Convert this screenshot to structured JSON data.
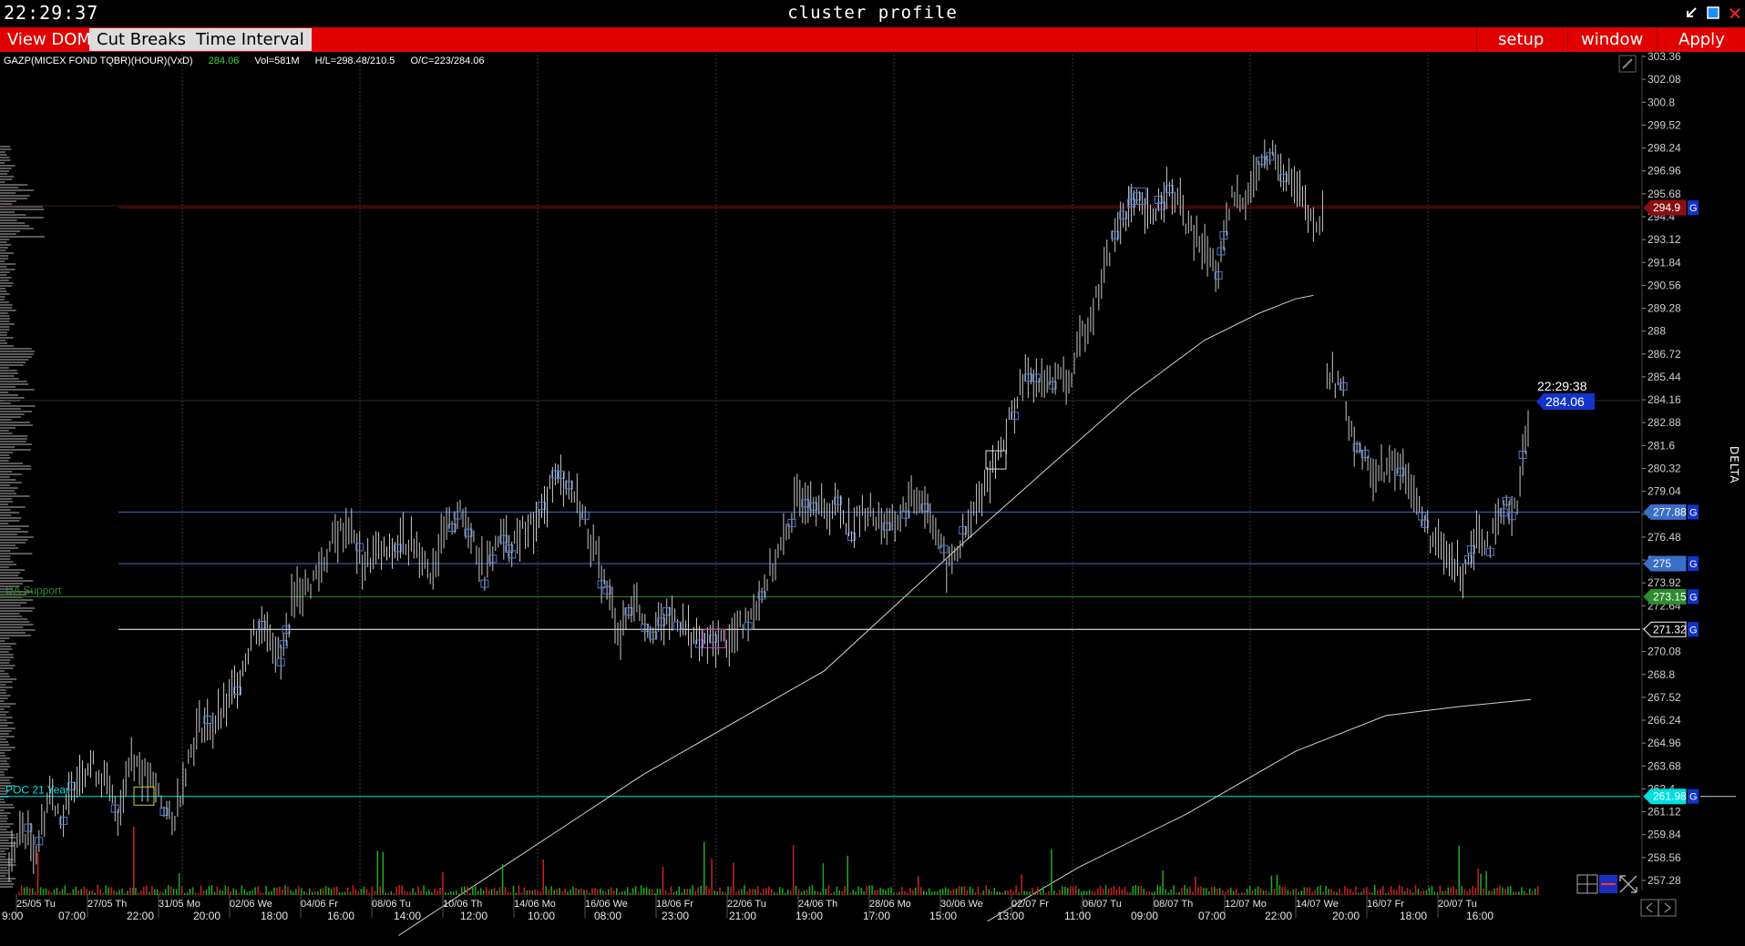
{
  "window": {
    "clock": "22:29:37",
    "title": "cluster profile"
  },
  "menu": {
    "view_dom": "View DOM",
    "cut_breaks": "Cut Breaks",
    "time_interval": "Time Interval",
    "setup": "setup",
    "window": "window",
    "apply": "Apply"
  },
  "info": {
    "symbol": "GAZP(MICEX FOND TQBR)(HOUR)(VxD)",
    "last": "284.06",
    "volume": "Vol=581M",
    "high_low": "H/L=298.48/210.5",
    "open_close": "O/C=223/284.06"
  },
  "colors": {
    "menu_red": "#e00000",
    "bull_volume": "#22aa22",
    "bear_volume": "#cc2222",
    "price_bar": "#c8c8c8",
    "blue_level": "#3a6ec8",
    "cyan_level": "#00e0e0",
    "green_level": "#2e8b2e",
    "red_level": "#8a1010",
    "last_price_tag": "#1133cc"
  },
  "chart_data": {
    "type": "candlestick-hourly",
    "y_ticks": [
      "303.36",
      "302.08",
      "300.8",
      "299.52",
      "298.24",
      "296.96",
      "295.68",
      "294.4",
      "293.12",
      "291.84",
      "290.56",
      "289.28",
      "288",
      "286.72",
      "285.44",
      "284.16",
      "282.88",
      "281.6",
      "280.32",
      "279.04",
      "277.76",
      "276.48",
      "275.2",
      "273.92",
      "272.64",
      "271.36",
      "270.08",
      "268.8",
      "267.52",
      "266.24",
      "264.96",
      "263.68",
      "262.4",
      "261.12",
      "259.84",
      "258.56",
      "257.28"
    ],
    "x_date_labels": [
      "25/05 Tu",
      "27/05 Th",
      "31/05 Mo",
      "02/06 We",
      "04/06 Fr",
      "08/06 Tu",
      "10/06 Th",
      "14/06 Mo",
      "16/06 We",
      "18/06 Fr",
      "22/06 Tu",
      "24/06 Th",
      "28/06 Mo",
      "30/06 We",
      "02/07 Fr",
      "06/07 Tu",
      "08/07 Th",
      "12/07 Mo",
      "14/07 We",
      "16/07 Fr",
      "20/07 Tu"
    ],
    "x_time_labels": [
      "9:00",
      "07:00",
      "22:00",
      "20:00",
      "18:00",
      "16:00",
      "14:00",
      "12:00",
      "10:00",
      "08:00",
      "23:00",
      "21:00",
      "19:00",
      "17:00",
      "15:00",
      "13:00",
      "11:00",
      "09:00",
      "07:00",
      "22:00",
      "20:00",
      "18:00",
      "16:00"
    ],
    "last_price": 284.06,
    "last_time": "22:29:38",
    "levels": [
      {
        "price": 294.9,
        "label": "294.9",
        "color": "#8a1010"
      },
      {
        "price": 277.88,
        "label": "277.88",
        "color": "#3a6ec8"
      },
      {
        "price": 275,
        "label": "275",
        "color": "#3a6ec8"
      },
      {
        "price": 273.15,
        "label": "273.15",
        "color": "#2e8b2e",
        "name": "DA Support"
      },
      {
        "price": 271.32,
        "label": "271.32",
        "color": "#ffffff"
      },
      {
        "price": 261.98,
        "label": "261.98",
        "color": "#00e0e0",
        "name": "POC 21 Year"
      }
    ],
    "price_path": [
      [
        0,
        258.3
      ],
      [
        15,
        260.2
      ],
      [
        30,
        259
      ],
      [
        45,
        262.3
      ],
      [
        60,
        260.7
      ],
      [
        75,
        263.3
      ],
      [
        90,
        263.8
      ],
      [
        105,
        262.9
      ],
      [
        120,
        261
      ],
      [
        135,
        264.4
      ],
      [
        150,
        263.1
      ],
      [
        165,
        262.2
      ],
      [
        180,
        260.3
      ],
      [
        195,
        263.6
      ],
      [
        210,
        266
      ],
      [
        225,
        265.9
      ],
      [
        240,
        267
      ],
      [
        255,
        268.8
      ],
      [
        270,
        271.2
      ],
      [
        285,
        271.6
      ],
      [
        300,
        269.4
      ],
      [
        315,
        273.5
      ],
      [
        330,
        273.6
      ],
      [
        345,
        274.9
      ],
      [
        360,
        276.5
      ],
      [
        375,
        277.2
      ],
      [
        390,
        274.9
      ],
      [
        405,
        275.6
      ],
      [
        420,
        275.5
      ],
      [
        435,
        276.3
      ],
      [
        450,
        276
      ],
      [
        465,
        274.6
      ],
      [
        480,
        276.5
      ],
      [
        495,
        277.9
      ],
      [
        510,
        276.9
      ],
      [
        525,
        274.4
      ],
      [
        540,
        276.4
      ],
      [
        555,
        276.1
      ],
      [
        570,
        277
      ],
      [
        585,
        277.1
      ],
      [
        600,
        279.8
      ],
      [
        615,
        279.6
      ],
      [
        630,
        278.3
      ],
      [
        645,
        275.8
      ],
      [
        660,
        273.5
      ],
      [
        675,
        271
      ],
      [
        690,
        273.2
      ],
      [
        705,
        271.5
      ],
      [
        720,
        271.5
      ],
      [
        735,
        272.1
      ],
      [
        750,
        271.2
      ],
      [
        765,
        270.4
      ],
      [
        780,
        270.7
      ],
      [
        795,
        270.7
      ],
      [
        810,
        271.5
      ],
      [
        825,
        272.8
      ],
      [
        840,
        274.5
      ],
      [
        855,
        276.2
      ],
      [
        870,
        278.6
      ],
      [
        885,
        279
      ],
      [
        900,
        277.8
      ],
      [
        915,
        278.3
      ],
      [
        930,
        277
      ],
      [
        945,
        278
      ],
      [
        960,
        277.5
      ],
      [
        975,
        277
      ],
      [
        990,
        278.2
      ],
      [
        1005,
        278.9
      ],
      [
        1020,
        277.5
      ],
      [
        1035,
        274.7
      ],
      [
        1050,
        276
      ],
      [
        1065,
        277.8
      ],
      [
        1080,
        279.8
      ],
      [
        1095,
        281.5
      ],
      [
        1110,
        283.8
      ],
      [
        1125,
        285.8
      ],
      [
        1140,
        284.9
      ],
      [
        1155,
        285.5
      ],
      [
        1170,
        285
      ],
      [
        1185,
        287.8
      ],
      [
        1200,
        289.7
      ],
      [
        1215,
        292.5
      ],
      [
        1230,
        294.6
      ],
      [
        1245,
        295
      ],
      [
        1260,
        294.2
      ],
      [
        1275,
        295.8
      ],
      [
        1290,
        295.3
      ],
      [
        1305,
        293.5
      ],
      [
        1320,
        292.5
      ],
      [
        1335,
        291.2
      ],
      [
        1350,
        295.4
      ],
      [
        1365,
        295.5
      ],
      [
        1380,
        297.1
      ],
      [
        1395,
        298
      ],
      [
        1410,
        296.8
      ],
      [
        1425,
        295.6
      ],
      [
        1440,
        293.6
      ],
      [
        1450,
        294.4
      ],
      [
        1450,
        294.4
      ]
    ],
    "price_path_2": [
      [
        1455,
        285.8
      ],
      [
        1470,
        284.9
      ],
      [
        1485,
        282
      ],
      [
        1500,
        280.2
      ],
      [
        1515,
        280.2
      ],
      [
        1530,
        280.5
      ],
      [
        1545,
        280
      ],
      [
        1560,
        277.5
      ],
      [
        1575,
        276
      ],
      [
        1590,
        275.2
      ],
      [
        1605,
        274.5
      ],
      [
        1620,
        276.8
      ],
      [
        1635,
        276.2
      ],
      [
        1650,
        277.8
      ],
      [
        1665,
        278.5
      ],
      [
        1680,
        284.06
      ]
    ],
    "vwap_upper": [
      [
        430,
        254.2
      ],
      [
        700,
        263.2
      ],
      [
        900,
        269
      ],
      [
        1050,
        276
      ],
      [
        1150,
        280.5
      ],
      [
        1240,
        284.5
      ],
      [
        1320,
        287.5
      ],
      [
        1380,
        289
      ],
      [
        1420,
        289.8
      ],
      [
        1440,
        290
      ]
    ],
    "vwap_lower": [
      [
        1080,
        255
      ],
      [
        1180,
        258
      ],
      [
        1300,
        261
      ],
      [
        1420,
        264.5
      ],
      [
        1520,
        266.5
      ],
      [
        1600,
        267
      ],
      [
        1680,
        267.4
      ]
    ]
  }
}
